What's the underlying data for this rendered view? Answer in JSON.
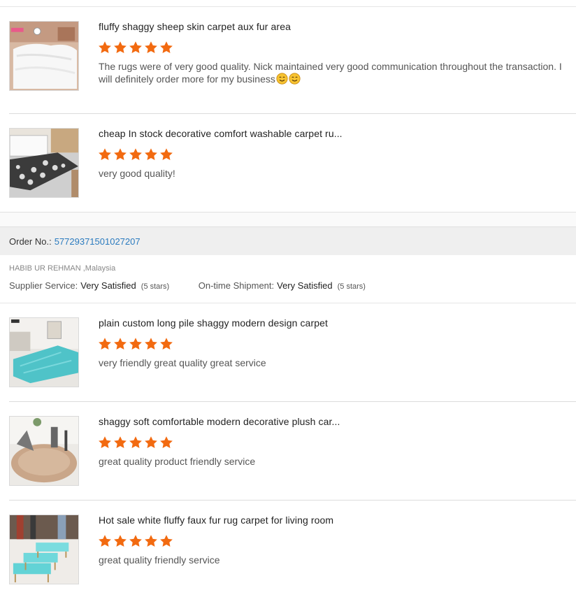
{
  "reviews_top": [
    {
      "title": "fluffy shaggy sheep skin carpet aux fur area",
      "rating": 5,
      "comment": "The rugs were of very good quality.  Nick maintained very good communication throughout the transaction. I will definitely order more for my business",
      "emoji_count": 2
    },
    {
      "title": "cheap In stock decorative comfort washable carpet ru...",
      "rating": 5,
      "comment": "very good quality!"
    }
  ],
  "order": {
    "label": "Order No.:",
    "number": "57729371501027207",
    "buyer": "HABIB UR REHMAN ,Malaysia",
    "supplier_label": "Supplier Service:",
    "supplier_value": "Very Satisfied",
    "supplier_stars": "(5 stars)",
    "shipment_label": "On-time Shipment:",
    "shipment_value": "Very Satisfied",
    "shipment_stars": "(5 stars)"
  },
  "reviews_bottom": [
    {
      "title": "plain custom long pile shaggy modern design carpet",
      "rating": 5,
      "comment": "very friendly great quality great service"
    },
    {
      "title": "shaggy soft comfortable modern decorative plush car...",
      "rating": 5,
      "comment": "great quality product friendly service"
    },
    {
      "title": "Hot sale white fluffy faux fur rug carpet for living room",
      "rating": 5,
      "comment": "great quality friendly service"
    }
  ],
  "colors": {
    "star": "#f26a10",
    "link": "#2b7bbf",
    "order_bar": "#efefef"
  },
  "icons": {
    "star": "star-icon",
    "emoji": "smiling-face-emoji-icon"
  }
}
